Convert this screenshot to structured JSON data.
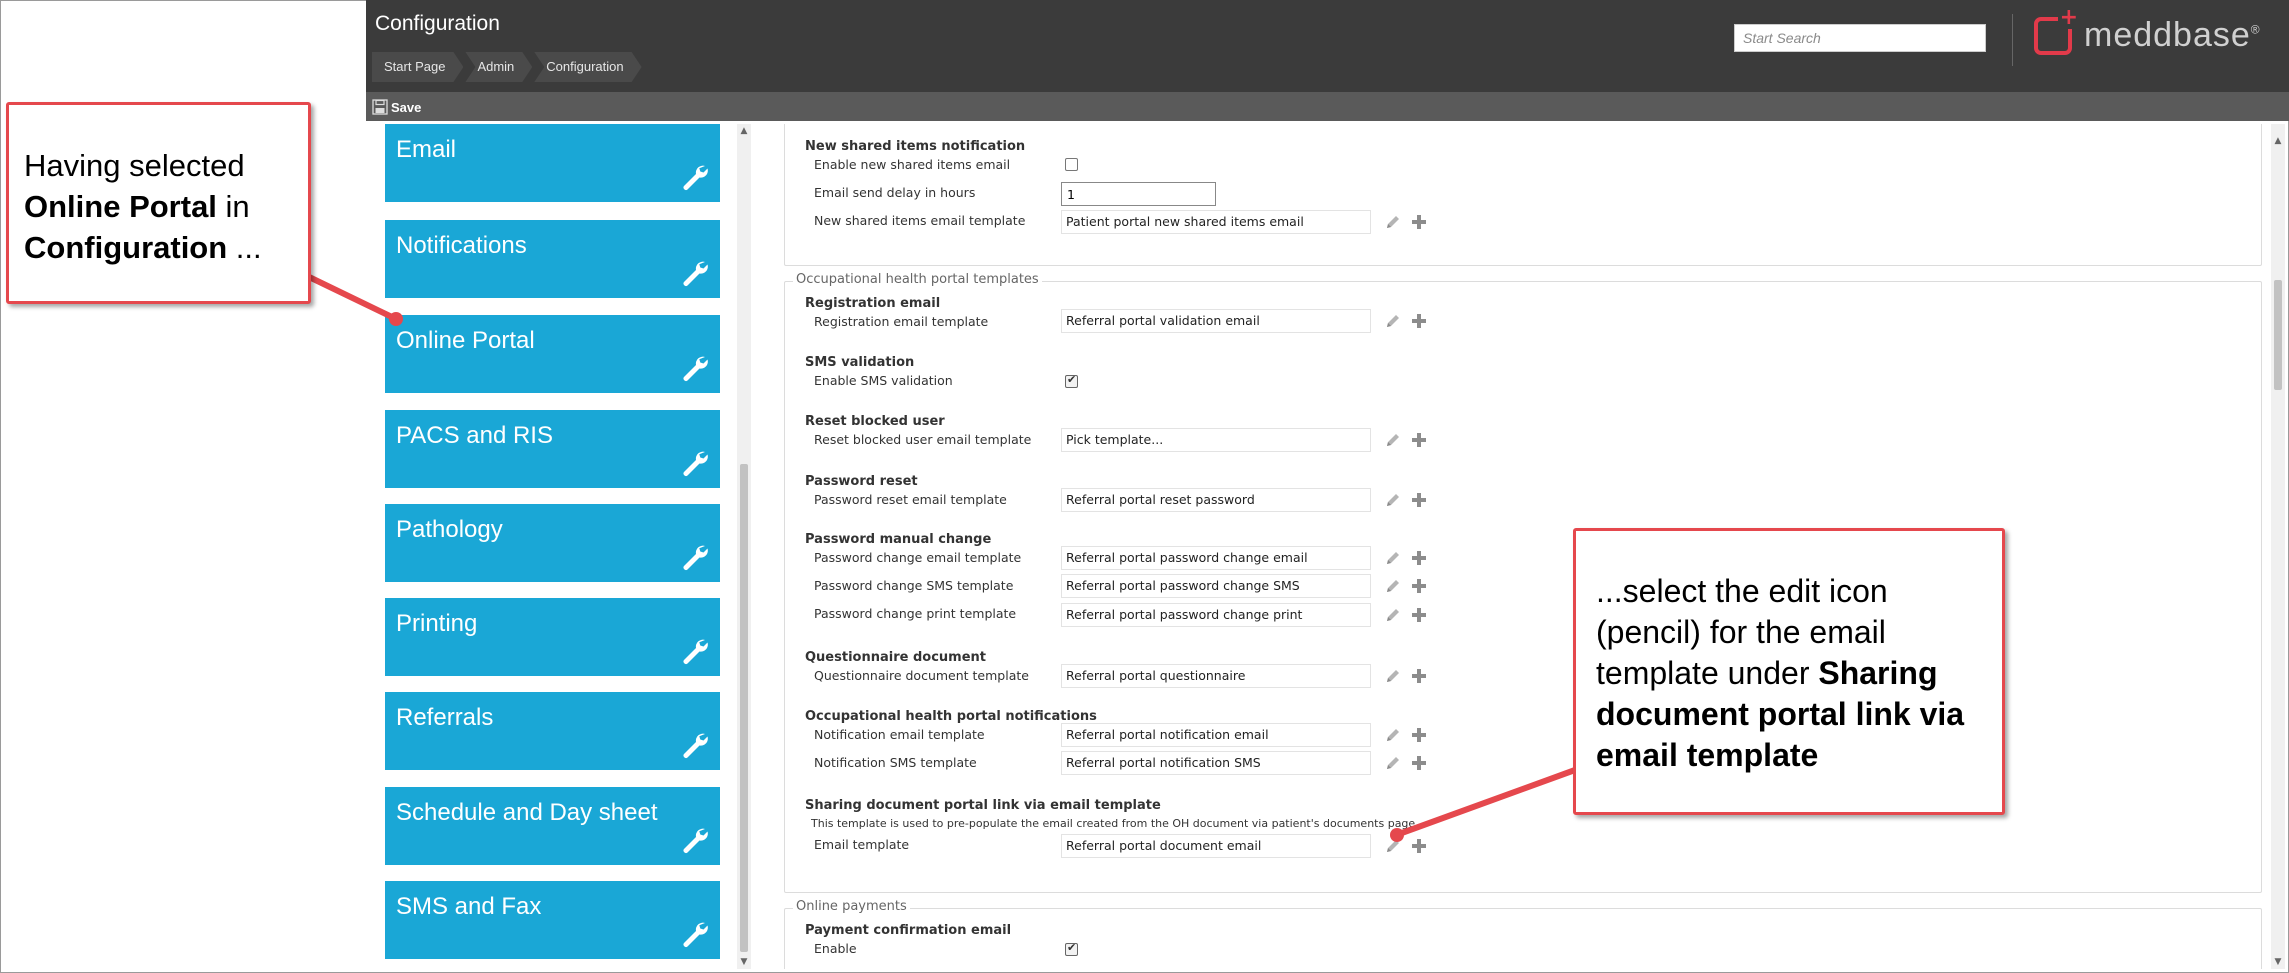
{
  "header": {
    "title": "Configuration",
    "breadcrumb": [
      "Start Page",
      "Admin",
      "Configuration"
    ],
    "search_placeholder": "Start Search",
    "logo_text": "meddbase",
    "logo_mark": "®"
  },
  "toolbar": {
    "save_label": "Save"
  },
  "nav": {
    "items": [
      {
        "label": "Email"
      },
      {
        "label": "Notifications"
      },
      {
        "label": "Online Portal"
      },
      {
        "label": "PACS and RIS"
      },
      {
        "label": "Pathology"
      },
      {
        "label": "Printing"
      },
      {
        "label": "Referrals"
      },
      {
        "label": "Schedule and Day sheet"
      },
      {
        "label": "SMS and Fax"
      }
    ]
  },
  "content": {
    "shared_items": {
      "title": "New shared items notification",
      "enable_label": "Enable new shared items email",
      "enable_checked": false,
      "delay_label": "Email send delay in hours",
      "delay_value": "1",
      "template_label": "New shared items email template",
      "template_value": "Patient portal new shared items email"
    },
    "oh_templates": {
      "legend": "Occupational health portal templates",
      "registration": {
        "title": "Registration email",
        "label": "Registration email template",
        "value": "Referral portal validation email"
      },
      "sms_validation": {
        "title": "SMS validation",
        "label": "Enable SMS validation",
        "checked": true
      },
      "reset_blocked": {
        "title": "Reset blocked user",
        "label": "Reset blocked user email template",
        "value": "Pick template..."
      },
      "password_reset": {
        "title": "Password reset",
        "label": "Password reset email template",
        "value": "Referral portal reset password"
      },
      "password_manual": {
        "title": "Password manual change",
        "email_label": "Password change email template",
        "email_value": "Referral portal password change email",
        "sms_label": "Password change SMS template",
        "sms_value": "Referral portal password change SMS",
        "print_label": "Password change print template",
        "print_value": "Referral portal password change print"
      },
      "questionnaire": {
        "title": "Questionnaire document",
        "label": "Questionnaire document template",
        "value": "Referral portal questionnaire"
      },
      "oh_notifications": {
        "title": "Occupational health portal notifications",
        "email_label": "Notification email template",
        "email_value": "Referral portal notification email",
        "sms_label": "Notification SMS template",
        "sms_value": "Referral portal notification SMS"
      },
      "sharing": {
        "title": "Sharing document portal link via email template",
        "description": "This template is used to pre-populate the email created from the OH document via patient's documents page",
        "label": "Email template",
        "value": "Referral portal document email"
      }
    },
    "online_payments": {
      "legend": "Online payments",
      "title": "Payment confirmation email",
      "enable_label": "Enable",
      "enable_checked": true
    }
  },
  "callouts": {
    "left": {
      "t1": "Having selected ",
      "b1": "Online Portal",
      "t2": " in ",
      "b2": "Configuration",
      "t3": " ..."
    },
    "right": {
      "t1": "...select the edit icon (pencil) for the email template under ",
      "b1": "Sharing document portal link via email template"
    }
  },
  "colors": {
    "header": "#3b3b3b",
    "toolbar": "#5a5a5a",
    "tile": "#1aa7d6",
    "callout_border": "#e5484d",
    "logo": "#e23a4a"
  }
}
